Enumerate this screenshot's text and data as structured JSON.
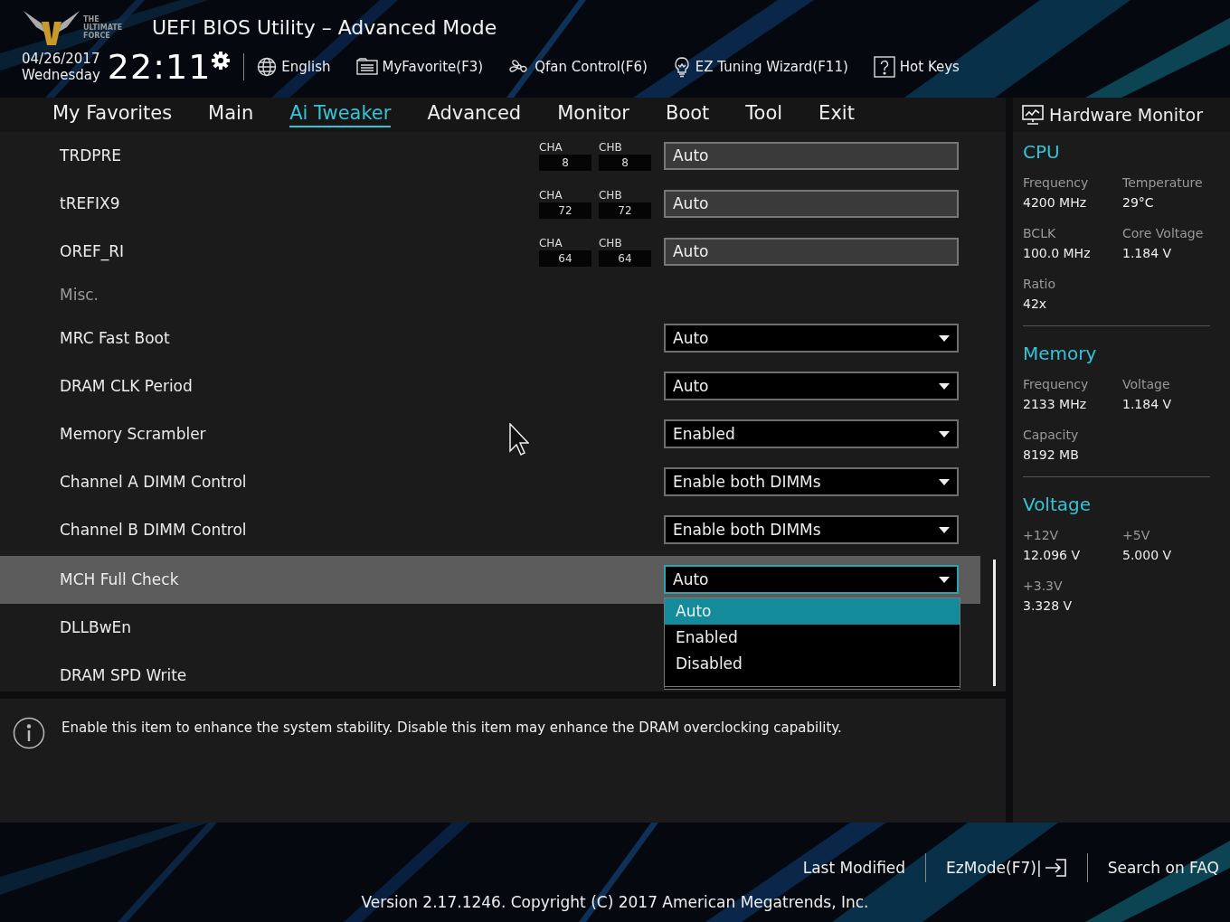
{
  "header": {
    "logo_text": "THE ULTIMATE FORCE",
    "title": "UEFI BIOS Utility – Advanced Mode",
    "date": "04/26/2017",
    "day": "Wednesday",
    "time": "22:11",
    "toolbar": [
      {
        "kind": "globe",
        "label": "English"
      },
      {
        "kind": "favorite",
        "label": "MyFavorite(F3)"
      },
      {
        "kind": "fan",
        "label": "Qfan Control(F6)"
      },
      {
        "kind": "bulb",
        "label": "EZ Tuning Wizard(F11)"
      },
      {
        "kind": "help",
        "label": "Hot Keys"
      }
    ]
  },
  "tabs": [
    {
      "label": "My Favorites",
      "selected": false
    },
    {
      "label": "Main",
      "selected": false
    },
    {
      "label": "Ai Tweaker",
      "selected": true
    },
    {
      "label": "Advanced",
      "selected": false
    },
    {
      "label": "Monitor",
      "selected": false
    },
    {
      "label": "Boot",
      "selected": false
    },
    {
      "label": "Tool",
      "selected": false
    },
    {
      "label": "Exit",
      "selected": false
    }
  ],
  "settings": [
    {
      "kind": "channel",
      "label": "TRDPRE",
      "cha_label": "CHA",
      "cha": "8",
      "chb_label": "CHB",
      "chb": "8",
      "value": "Auto",
      "selected": false
    },
    {
      "kind": "channel",
      "label": "tREFIX9",
      "cha_label": "CHA",
      "cha": "72",
      "chb_label": "CHB",
      "chb": "72",
      "value": "Auto",
      "selected": false
    },
    {
      "kind": "channel",
      "label": "OREF_RI",
      "cha_label": "CHA",
      "cha": "64",
      "chb_label": "CHB",
      "chb": "64",
      "value": "Auto",
      "selected": false
    },
    {
      "kind": "section",
      "label": "Misc."
    },
    {
      "kind": "dropdown",
      "label": "MRC Fast Boot",
      "value": "Auto",
      "selected": false
    },
    {
      "kind": "dropdown",
      "label": "DRAM CLK Period",
      "value": "Auto",
      "selected": false
    },
    {
      "kind": "dropdown",
      "label": "Memory Scrambler",
      "value": "Enabled",
      "selected": false
    },
    {
      "kind": "dropdown",
      "label": "Channel A DIMM Control",
      "value": "Enable both DIMMs",
      "selected": false
    },
    {
      "kind": "dropdown",
      "label": "Channel B DIMM Control",
      "value": "Enable both DIMMs",
      "selected": false
    },
    {
      "kind": "dropdown",
      "label": "MCH Full Check",
      "value": "Auto",
      "selected": true,
      "expanded": true,
      "options": [
        {
          "label": "Auto",
          "selected": true
        },
        {
          "label": "Enabled",
          "selected": false
        },
        {
          "label": "Disabled",
          "selected": false
        }
      ]
    },
    {
      "kind": "plain",
      "label": "DLLBwEn",
      "selected": false
    },
    {
      "kind": "plain",
      "label": "DRAM SPD Write",
      "selected": false
    }
  ],
  "help": {
    "text": "Enable this item to enhance the system stability. Disable this item may enhance the DRAM overclocking capability."
  },
  "hardware_monitor": {
    "title": "Hardware Monitor",
    "sections": [
      {
        "title": "CPU",
        "items": [
          {
            "label": "Frequency",
            "value": "4200 MHz"
          },
          {
            "label": "Temperature",
            "value": "29°C"
          },
          {
            "label": "BCLK",
            "value": "100.0 MHz"
          },
          {
            "label": "Core Voltage",
            "value": "1.184 V"
          },
          {
            "label": "Ratio",
            "value": "42x"
          }
        ]
      },
      {
        "title": "Memory",
        "items": [
          {
            "label": "Frequency",
            "value": "2133 MHz"
          },
          {
            "label": "Voltage",
            "value": "1.184 V"
          },
          {
            "label": "Capacity",
            "value": "8192 MB"
          }
        ]
      },
      {
        "title": "Voltage",
        "items": [
          {
            "label": "+12V",
            "value": "12.096 V"
          },
          {
            "label": "+5V",
            "value": "5.000 V"
          },
          {
            "label": "+3.3V",
            "value": "3.328 V"
          }
        ]
      }
    ]
  },
  "footer": {
    "links": [
      {
        "kind": "text",
        "label": "Last Modified"
      },
      {
        "kind": "exit",
        "label": "EzMode(F7)|"
      },
      {
        "kind": "text",
        "label": "Search on FAQ"
      }
    ],
    "version": "Version 2.17.1246. Copyright (C) 2017 American Megatrends, Inc."
  }
}
